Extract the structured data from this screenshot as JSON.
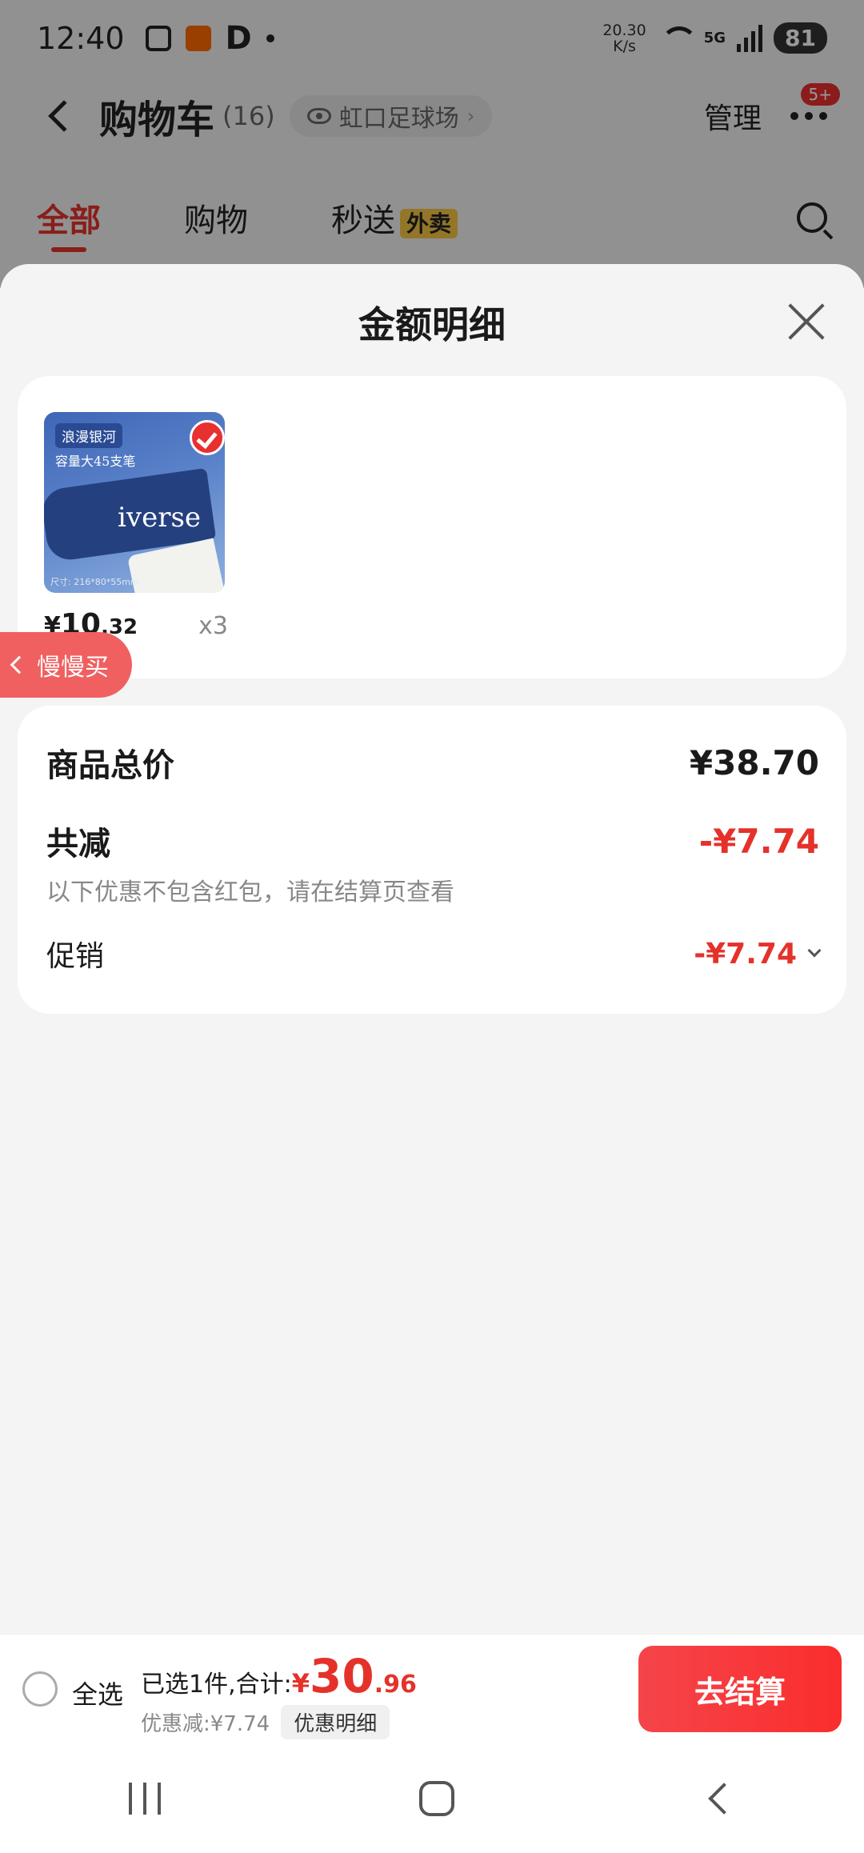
{
  "status_bar": {
    "time": "12:40",
    "net_speed_value": "20.30",
    "net_speed_unit": "K/s",
    "network": "5G",
    "battery": "81"
  },
  "header": {
    "title": "购物车",
    "count": "(16)",
    "location": "虹口足球场",
    "manage": "管理",
    "badge": "5+"
  },
  "tabs": [
    {
      "label": "全部",
      "active": true
    },
    {
      "label": "购物",
      "active": false
    },
    {
      "label": "秒送",
      "active": false,
      "tag": "外卖"
    }
  ],
  "sheet": {
    "title": "金额明细",
    "product": {
      "thumb_tag": "浪漫银河",
      "thumb_subtag": "容量大45支笔",
      "thumb_word": "iverse",
      "thumb_size": "尺寸: 216*80*55mm",
      "price_symbol": "¥",
      "price_int": "10",
      "price_dec": ".32",
      "quantity": "x3"
    },
    "slow_buy": "慢慢买",
    "summary": {
      "total_label": "商品总价",
      "total_value": "¥38.70",
      "reduce_label": "共减",
      "reduce_value": "-¥7.74",
      "reduce_note": "以下优惠不包含红包，请在结算页查看",
      "promo_label": "促销",
      "promo_value": "-¥7.74"
    }
  },
  "checkout": {
    "select_all": "全选",
    "selected_text": "已选1件,合计:",
    "total_symbol": "¥",
    "total_int": "30",
    "total_dec": ".96",
    "discount_text": "优惠减:¥7.74",
    "detail_button": "优惠明细",
    "checkout_button": "去结算"
  },
  "colors": {
    "accent_red": "#e4322b",
    "checkout_button": "#f5454a",
    "tag_yellow": "#f6c544"
  }
}
